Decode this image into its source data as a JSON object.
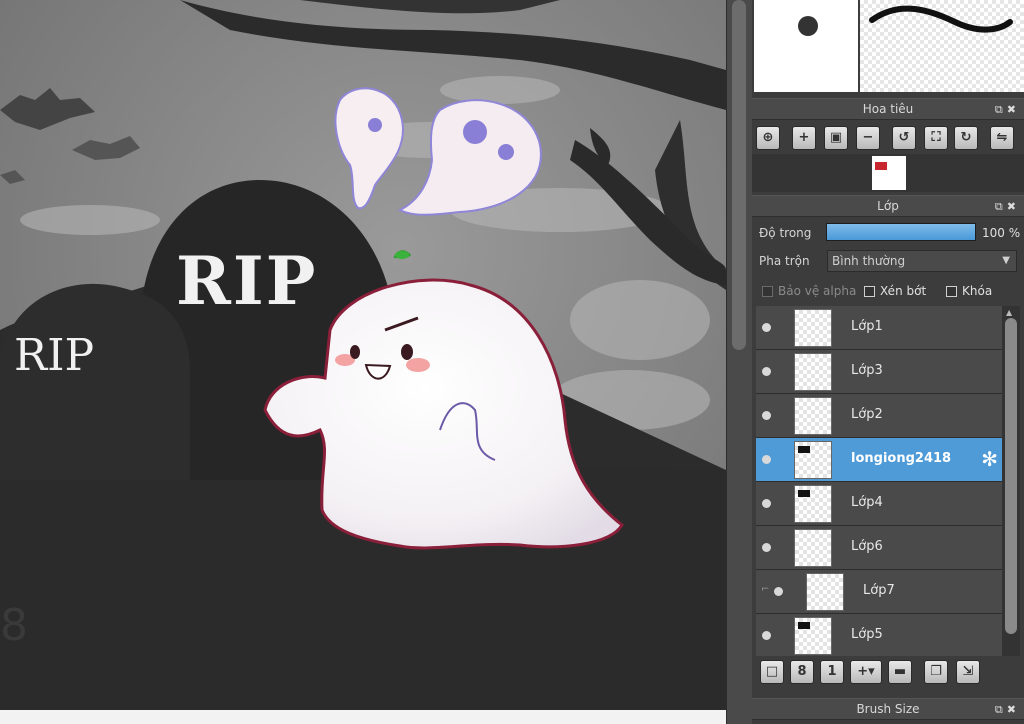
{
  "canvas": {
    "rip_big": "RIP",
    "rip_small": "RIP",
    "corner_digit": "8"
  },
  "navigator": {
    "title": "Hoa tiêu",
    "tools": [
      "zoom-in-magnifier-icon",
      "zoom-in-icon",
      "fit-icon",
      "zoom-out-icon",
      "rotate-left-icon",
      "fullscreen-icon",
      "rotate-right-icon",
      "flip-icon"
    ]
  },
  "layers_panel": {
    "title": "Lớp",
    "opacity_label": "Độ trong",
    "opacity_value": "100 %",
    "opacity_fraction": 1.0,
    "blend_label": "Pha trộn",
    "blend_value": "Bình thường",
    "protect_alpha": "Bảo vệ alpha",
    "clipping": "Xén bớt",
    "lock": "Khóa",
    "layers": [
      {
        "name": "Lớp1",
        "active": false,
        "clipped": false,
        "thumb_mark": false
      },
      {
        "name": "Lớp3",
        "active": false,
        "clipped": false,
        "thumb_mark": false
      },
      {
        "name": "Lớp2",
        "active": false,
        "clipped": false,
        "thumb_mark": false
      },
      {
        "name": "longiong2418",
        "active": true,
        "clipped": false,
        "thumb_mark": true
      },
      {
        "name": "Lớp4",
        "active": false,
        "clipped": false,
        "thumb_mark": true
      },
      {
        "name": "Lớp6",
        "active": false,
        "clipped": false,
        "thumb_mark": false
      },
      {
        "name": "Lớp7",
        "active": false,
        "clipped": true,
        "thumb_mark": false
      },
      {
        "name": "Lớp5",
        "active": false,
        "clipped": false,
        "thumb_mark": true
      }
    ]
  },
  "brush_size": {
    "title": "Brush Size"
  },
  "colors": {
    "accent": "#4f9bd8",
    "panel_bg": "#3c3c3c"
  }
}
